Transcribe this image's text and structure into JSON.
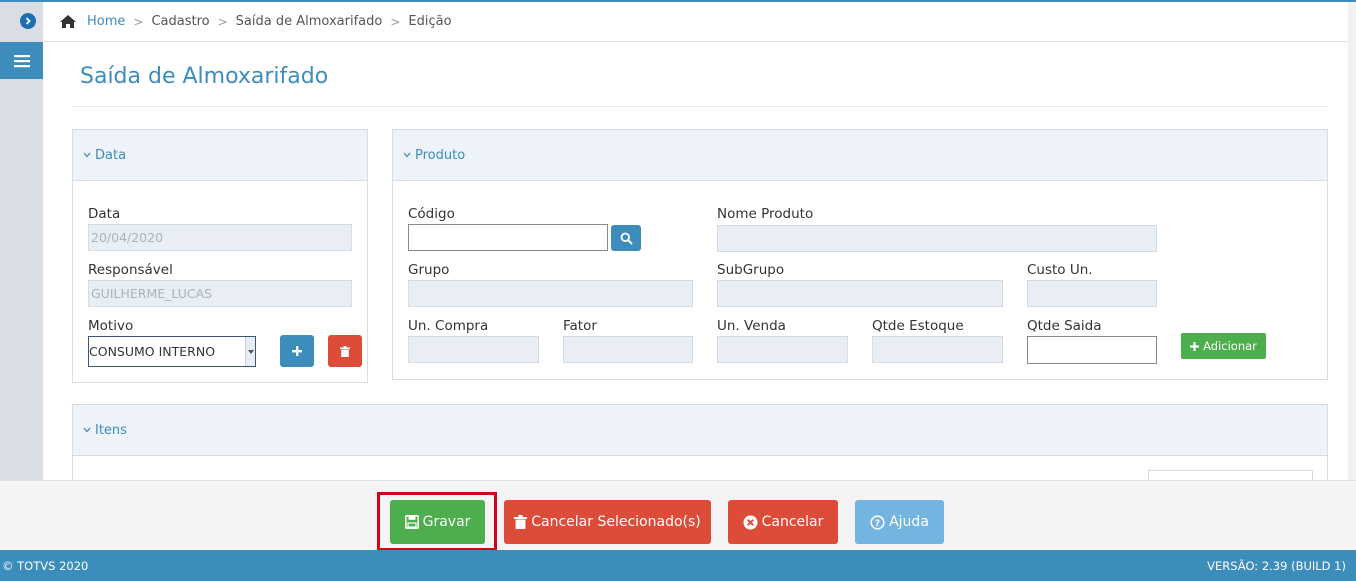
{
  "breadcrumb": {
    "home": "Home",
    "items": [
      "Cadastro",
      "Saída de Almoxarifado",
      "Edição"
    ]
  },
  "page": {
    "title": "Saída de Almoxarifado"
  },
  "data_panel": {
    "header": "Data",
    "data_label": "Data",
    "data_value": "20/04/2020",
    "responsavel_label": "Responsável",
    "responsavel_value": "GUILHERME_LUCAS",
    "motivo_label": "Motivo",
    "motivo_value": "CONSUMO INTERNO"
  },
  "produto_panel": {
    "header": "Produto",
    "codigo_label": "Código",
    "codigo_value": "",
    "nome_label": "Nome Produto",
    "grupo_label": "Grupo",
    "subgrupo_label": "SubGrupo",
    "custo_label": "Custo Un.",
    "uncompra_label": "Un. Compra",
    "fator_label": "Fator",
    "unvenda_label": "Un. Venda",
    "qtdestoque_label": "Qtde Estoque",
    "qtdsaida_label": "Qtde Saida",
    "qtdsaida_value": "",
    "adicionar_label": "Adicionar"
  },
  "itens_panel": {
    "header": "Itens"
  },
  "actions": {
    "gravar": "Gravar",
    "cancelar_selecionados": "Cancelar Selecionado(s)",
    "cancelar": "Cancelar",
    "ajuda": "Ajuda"
  },
  "status": {
    "copyright": "© TOTVS 2020",
    "version": "VERSÃO: 2.39 (BUILD 1)"
  },
  "colors": {
    "primary": "#3c8dbc",
    "success": "#4cae4c",
    "danger": "#dd4b39",
    "info": "#73b4e0",
    "highlight": "#d0021b"
  }
}
